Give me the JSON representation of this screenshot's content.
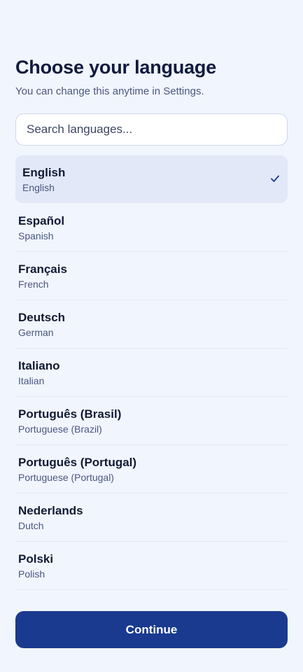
{
  "header": {
    "title": "Choose your language",
    "subtitle": "You can change this anytime in Settings."
  },
  "search": {
    "placeholder": "Search languages...",
    "value": ""
  },
  "languages": [
    {
      "native": "English",
      "english": "English",
      "selected": true
    },
    {
      "native": "Español",
      "english": "Spanish",
      "selected": false
    },
    {
      "native": "Français",
      "english": "French",
      "selected": false
    },
    {
      "native": "Deutsch",
      "english": "German",
      "selected": false
    },
    {
      "native": "Italiano",
      "english": "Italian",
      "selected": false
    },
    {
      "native": "Português (Brasil)",
      "english": "Portuguese (Brazil)",
      "selected": false
    },
    {
      "native": "Português (Portugal)",
      "english": "Portuguese (Portugal)",
      "selected": false
    },
    {
      "native": "Nederlands",
      "english": "Dutch",
      "selected": false
    },
    {
      "native": "Polski",
      "english": "Polish",
      "selected": false
    }
  ],
  "actions": {
    "continue_label": "Continue"
  },
  "colors": {
    "accent": "#1a3a8f",
    "background": "#f1f5fe",
    "selected_row": "#e2e8f7"
  },
  "icons": {
    "selected_indicator": "checkmark-icon"
  }
}
